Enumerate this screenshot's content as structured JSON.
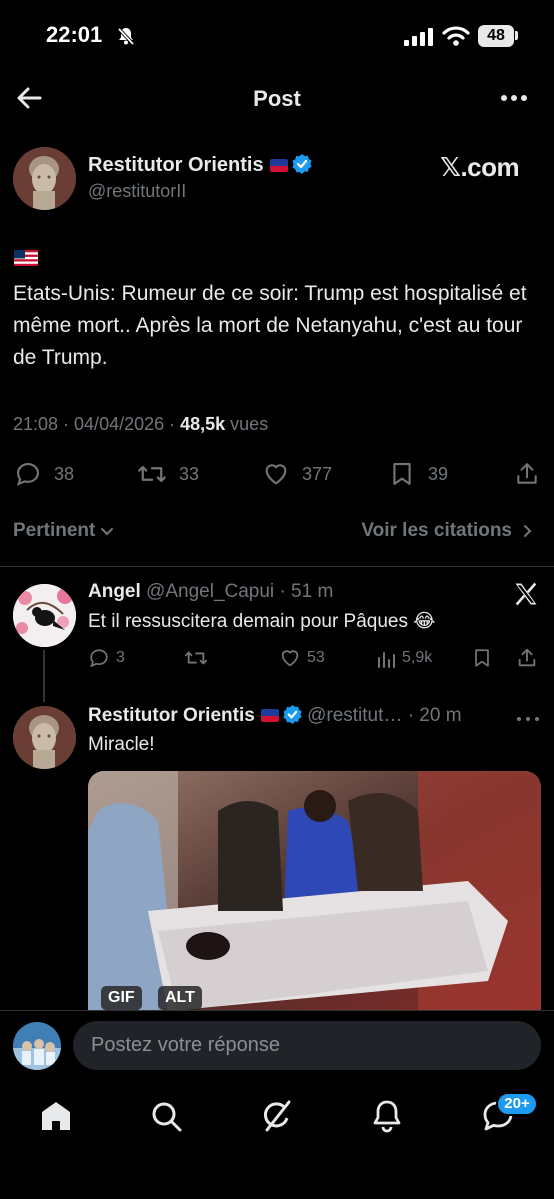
{
  "status_bar": {
    "time": "22:01",
    "battery": "48"
  },
  "header": {
    "title": "Post",
    "back_icon": "arrow-left-icon",
    "more_icon": "more-horizontal-icon"
  },
  "post": {
    "author_name": "Restitutor Orientis",
    "author_handle": "@restitutorII",
    "source_label": "𝕏.com",
    "flag_emoji": "🇺🇸",
    "text": "Etats-Unis: Rumeur de ce soir: Trump est hospitalisé et même mort.. Après la mort de Netanyahu, c'est au tour de Trump.",
    "timestamp": "21:08 · 04/04/2026 · ",
    "views_count": "48,5k",
    "views_label": " vues",
    "stats": {
      "replies": "38",
      "reposts": "33",
      "likes": "377",
      "bookmarks": "39"
    }
  },
  "sort": {
    "relevance_label": "Pertinent",
    "quotes_label": "Voir les citations"
  },
  "replies": [
    {
      "name": "Angel",
      "handle": "@Angel_Capui",
      "time": "· 51 m",
      "text": "Et il ressuscitera demain pour Pâques 😂",
      "replies": "3",
      "reposts": "",
      "likes": "53",
      "views": "5,9k"
    },
    {
      "name": "Restitutor Orientis",
      "handle": "@restitut…",
      "time": "· 20 m",
      "text": "Miracle!",
      "badges": {
        "gif": "GIF",
        "alt": "ALT"
      }
    }
  ],
  "composer": {
    "placeholder": "Postez votre réponse"
  },
  "nav": {
    "messages_badge": "20+"
  },
  "colors": {
    "accent": "#1d9bf0",
    "background": "#000000",
    "muted": "#71767b",
    "like": "#71767b"
  }
}
